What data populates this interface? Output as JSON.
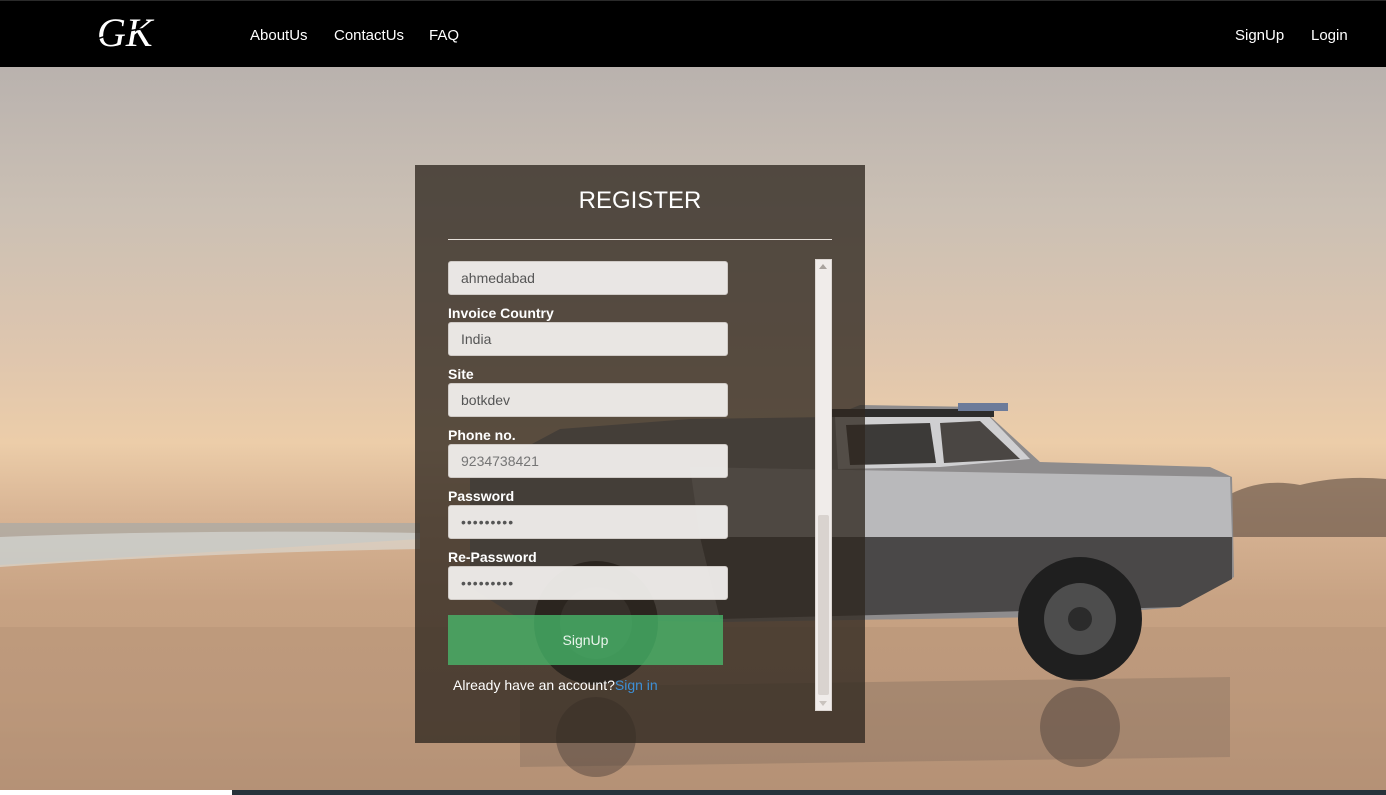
{
  "navbar": {
    "logo_text": "GK",
    "links": [
      "AboutUs",
      "ContactUs",
      "FAQ"
    ],
    "signup": "SignUp",
    "login": "Login"
  },
  "register": {
    "title": "REGISTER",
    "fields": {
      "city": {
        "value": "ahmedabad"
      },
      "invoice_country": {
        "label": "Invoice Country",
        "value": "India"
      },
      "site": {
        "label": "Site",
        "value": "botkdev"
      },
      "phone": {
        "label": "Phone no.",
        "placeholder": "9234738421"
      },
      "password": {
        "label": "Password",
        "value": "123456789"
      },
      "re_password": {
        "label": "Re-Password",
        "value": "123456789"
      }
    },
    "signup_button": "SignUp",
    "account_prompt": "Already have an account?",
    "signin_link": "Sign in"
  },
  "colors": {
    "navbar_bg": "#000000",
    "panel_bg": "#302820",
    "signup_button": "#48be6e",
    "link": "#3d8fd6"
  }
}
